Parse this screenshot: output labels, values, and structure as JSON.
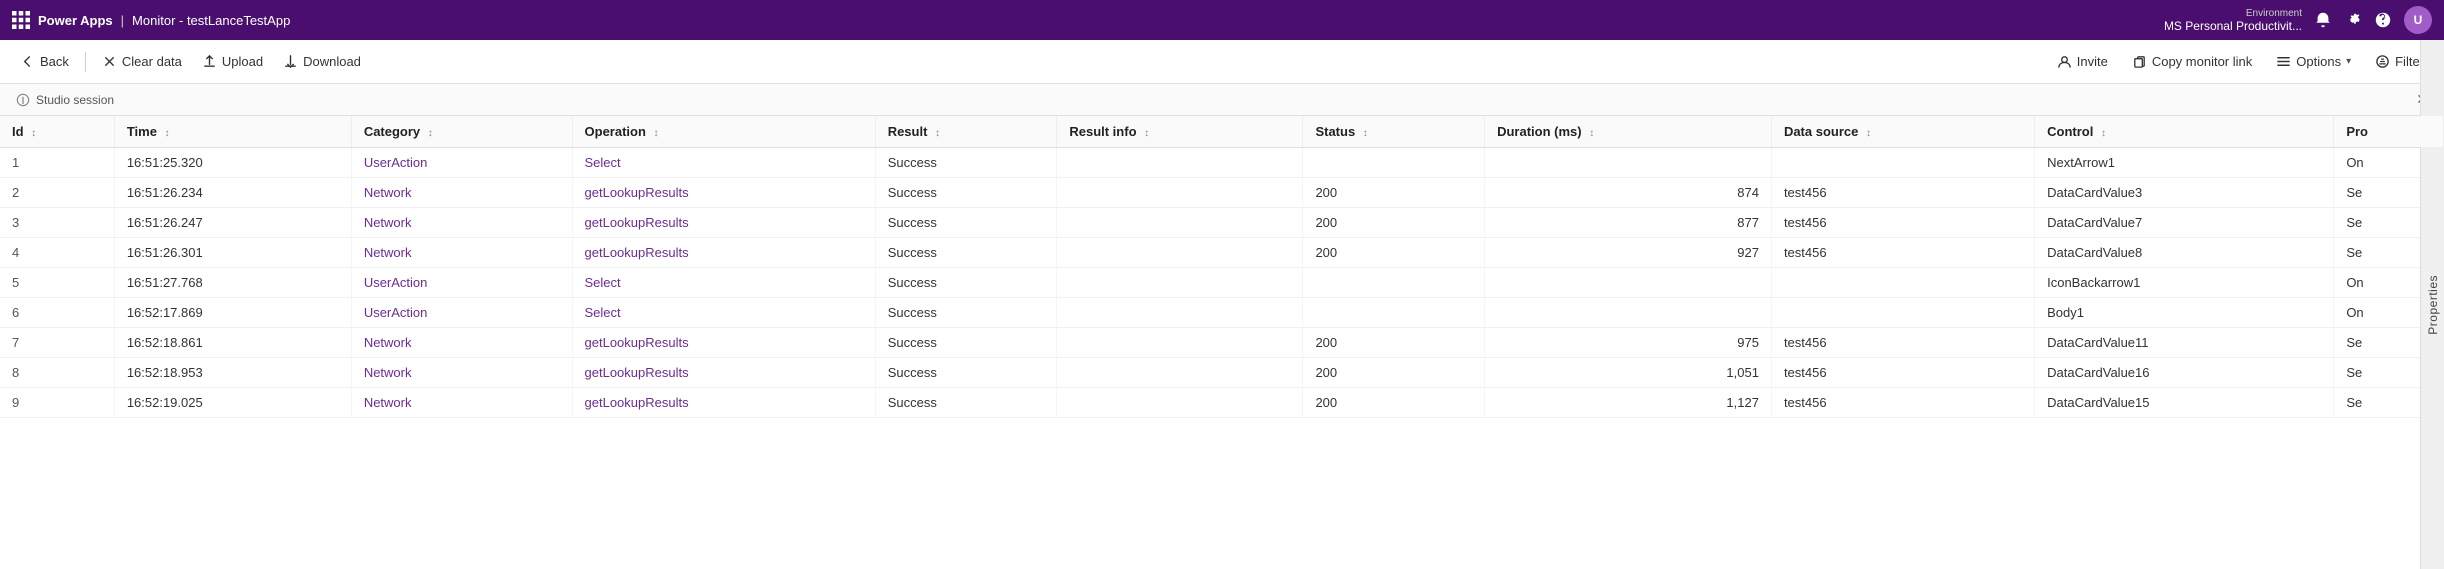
{
  "topbar": {
    "grid_label": "Power Apps",
    "separator": "|",
    "title": "Monitor - testLanceTestApp",
    "environment_label": "Environment",
    "environment_name": "MS Personal Productivit...",
    "avatar_initials": "U"
  },
  "actionbar": {
    "back_label": "Back",
    "clear_data_label": "Clear data",
    "upload_label": "Upload",
    "download_label": "Download",
    "invite_label": "Invite",
    "copy_monitor_link_label": "Copy monitor link",
    "options_label": "Options",
    "filter_label": "Filter"
  },
  "infobar": {
    "label": "Studio session"
  },
  "table": {
    "columns": [
      {
        "id": "id",
        "label": "Id",
        "sortable": true
      },
      {
        "id": "time",
        "label": "Time",
        "sortable": true
      },
      {
        "id": "category",
        "label": "Category",
        "sortable": true
      },
      {
        "id": "operation",
        "label": "Operation",
        "sortable": true
      },
      {
        "id": "result",
        "label": "Result",
        "sortable": true
      },
      {
        "id": "result_info",
        "label": "Result info",
        "sortable": true
      },
      {
        "id": "status",
        "label": "Status",
        "sortable": true
      },
      {
        "id": "duration_ms",
        "label": "Duration (ms)",
        "sortable": true
      },
      {
        "id": "data_source",
        "label": "Data source",
        "sortable": true
      },
      {
        "id": "control",
        "label": "Control",
        "sortable": true
      },
      {
        "id": "properties",
        "label": "Pro",
        "sortable": false
      }
    ],
    "rows": [
      {
        "id": 1,
        "time": "16:51:25.320",
        "category": "UserAction",
        "operation": "Select",
        "result": "Success",
        "result_info": "",
        "status": "",
        "duration_ms": "",
        "data_source": "",
        "control": "NextArrow1",
        "properties": "On"
      },
      {
        "id": 2,
        "time": "16:51:26.234",
        "category": "Network",
        "operation": "getLookupResults",
        "result": "Success",
        "result_info": "",
        "status": "200",
        "duration_ms": "874",
        "data_source": "test456",
        "control": "DataCardValue3",
        "properties": "Se"
      },
      {
        "id": 3,
        "time": "16:51:26.247",
        "category": "Network",
        "operation": "getLookupResults",
        "result": "Success",
        "result_info": "",
        "status": "200",
        "duration_ms": "877",
        "data_source": "test456",
        "control": "DataCardValue7",
        "properties": "Se"
      },
      {
        "id": 4,
        "time": "16:51:26.301",
        "category": "Network",
        "operation": "getLookupResults",
        "result": "Success",
        "result_info": "",
        "status": "200",
        "duration_ms": "927",
        "data_source": "test456",
        "control": "DataCardValue8",
        "properties": "Se"
      },
      {
        "id": 5,
        "time": "16:51:27.768",
        "category": "UserAction",
        "operation": "Select",
        "result": "Success",
        "result_info": "",
        "status": "",
        "duration_ms": "",
        "data_source": "",
        "control": "IconBackarrow1",
        "properties": "On"
      },
      {
        "id": 6,
        "time": "16:52:17.869",
        "category": "UserAction",
        "operation": "Select",
        "result": "Success",
        "result_info": "",
        "status": "",
        "duration_ms": "",
        "data_source": "",
        "control": "Body1",
        "properties": "On"
      },
      {
        "id": 7,
        "time": "16:52:18.861",
        "category": "Network",
        "operation": "getLookupResults",
        "result": "Success",
        "result_info": "",
        "status": "200",
        "duration_ms": "975",
        "data_source": "test456",
        "control": "DataCardValue11",
        "properties": "Se"
      },
      {
        "id": 8,
        "time": "16:52:18.953",
        "category": "Network",
        "operation": "getLookupResults",
        "result": "Success",
        "result_info": "",
        "status": "200",
        "duration_ms": "1,051",
        "data_source": "test456",
        "control": "DataCardValue16",
        "properties": "Se"
      },
      {
        "id": 9,
        "time": "16:52:19.025",
        "category": "Network",
        "operation": "getLookupResults",
        "result": "Success",
        "result_info": "",
        "status": "200",
        "duration_ms": "1,127",
        "data_source": "test456",
        "control": "DataCardValue15",
        "properties": "Se"
      }
    ]
  },
  "properties_panel": {
    "label": "Properties"
  }
}
